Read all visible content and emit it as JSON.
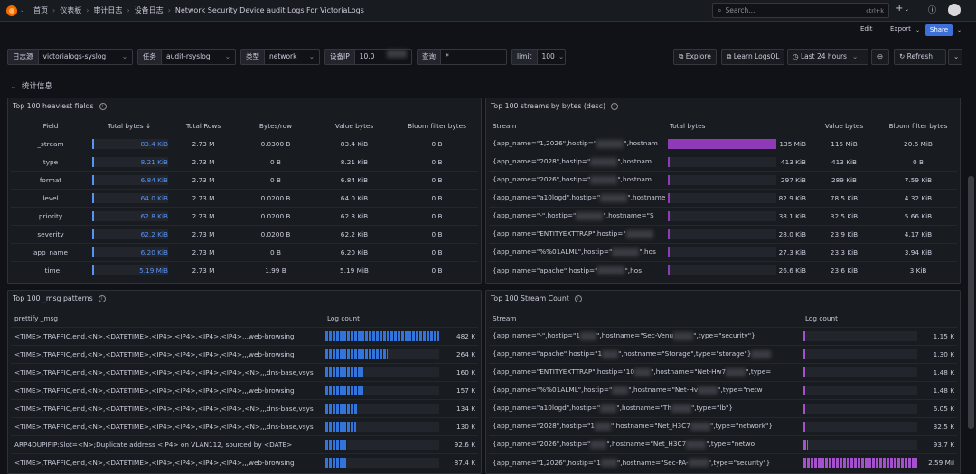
{
  "breadcrumb": [
    "首页",
    "仪表板",
    "审计日志",
    "设备日志",
    "Network Security Device audit Logs For VictoriaLogs"
  ],
  "search": {
    "placeholder": "Search...",
    "shortcut": "ctrl+k"
  },
  "toolbar": {
    "edit": "Edit",
    "export": "Export",
    "share": "Share"
  },
  "filters": [
    {
      "label": "日志源",
      "value": "victorialogs-syslog"
    },
    {
      "label": "任务",
      "value": "audit-rsyslog"
    },
    {
      "label": "类型",
      "value": "network"
    },
    {
      "label": "设备IP",
      "value": "10.0"
    },
    {
      "label": "查询",
      "value": "*"
    },
    {
      "label": "limit",
      "value": "100"
    }
  ],
  "actions": {
    "explore": "Explore",
    "learn": "Learn LogsQL",
    "time_range": "Last 24 hours",
    "refresh": "Refresh"
  },
  "section_title": "统计信息",
  "colors": {
    "blue": "#5794f2",
    "purple": "#8f3bb8",
    "share": "#3d71d9"
  },
  "heaviest_fields": {
    "title": "Top 100 heaviest fields",
    "columns": [
      "Field",
      "Total bytes ↓",
      "Total Rows",
      "Bytes/row",
      "Value bytes",
      "Bloom filter bytes"
    ],
    "rows": [
      {
        "field": "_stream",
        "total_bytes": "83.4 KiB",
        "frac": 1.0,
        "rows": "2.73 M",
        "bpr": "0.0300 B",
        "value_bytes": "83.4 KiB",
        "bloom": "0 B"
      },
      {
        "field": "type",
        "total_bytes": "8.21 KiB",
        "frac": 0.1,
        "rows": "2.73 M",
        "bpr": "0 B",
        "value_bytes": "8.21 KiB",
        "bloom": "0 B"
      },
      {
        "field": "format",
        "total_bytes": "6.84 KiB",
        "frac": 0.08,
        "rows": "2.73 M",
        "bpr": "0 B",
        "value_bytes": "6.84 KiB",
        "bloom": "0 B"
      },
      {
        "field": "level",
        "total_bytes": "64.0 KiB",
        "frac": 0.77,
        "rows": "2.73 M",
        "bpr": "0.0200 B",
        "value_bytes": "64.0 KiB",
        "bloom": "0 B"
      },
      {
        "field": "priority",
        "total_bytes": "62.8 KiB",
        "frac": 0.75,
        "rows": "2.73 M",
        "bpr": "0.0200 B",
        "value_bytes": "62.8 KiB",
        "bloom": "0 B"
      },
      {
        "field": "severity",
        "total_bytes": "62.2 KiB",
        "frac": 0.75,
        "rows": "2.73 M",
        "bpr": "0.0200 B",
        "value_bytes": "62.2 KiB",
        "bloom": "0 B"
      },
      {
        "field": "app_name",
        "total_bytes": "6.20 KiB",
        "frac": 0.07,
        "rows": "2.73 M",
        "bpr": "0 B",
        "value_bytes": "6.20 KiB",
        "bloom": "0 B"
      },
      {
        "field": "_time",
        "total_bytes": "5.19 MiB",
        "frac": 0.06,
        "rows": "2.73 M",
        "bpr": "1.99 B",
        "value_bytes": "5.19 MiB",
        "bloom": "0 B"
      }
    ]
  },
  "streams_by_bytes": {
    "title": "Top 100 streams by bytes (desc)",
    "columns": [
      "Stream",
      "Total bytes",
      "Value bytes",
      "Bloom filter bytes"
    ],
    "rows": [
      {
        "stream": "{app_name=\"1,2026\",hostip=\"",
        "stream2": "\",hostnam",
        "total": "135 MiB",
        "frac": 1.0,
        "value": "115 MiB",
        "bloom": "20.6 MiB"
      },
      {
        "stream": "{app_name=\"2028\",hostip=\"",
        "stream2": "\",hostnam",
        "total": "413 KiB",
        "frac": 0.0,
        "value": "413 KiB",
        "bloom": "0 B"
      },
      {
        "stream": "{app_name=\"2026\",hostip=\"",
        "stream2": "\",hostnam",
        "total": "297 KiB",
        "frac": 0.0,
        "value": "289 KiB",
        "bloom": "7.59 KiB"
      },
      {
        "stream": "{app_name=\"a10logd\",hostip=\"",
        "stream2": "\",hostname=\"",
        "total": "82.9 KiB",
        "frac": 0.0,
        "value": "78.5 KiB",
        "bloom": "4.32 KiB"
      },
      {
        "stream": "{app_name=\"-\",hostip=\"",
        "stream2": "\",hostname=\"S",
        "total": "38.1 KiB",
        "frac": 0.0,
        "value": "32.5 KiB",
        "bloom": "5.66 KiB"
      },
      {
        "stream": "{app_name=\"ENTITYEXTTRAP\",hostip=\"",
        "stream2": "",
        "total": "28.0 KiB",
        "frac": 0.0,
        "value": "23.9 KiB",
        "bloom": "4.17 KiB"
      },
      {
        "stream": "{app_name=\"%%01ALML\",hostip=\"",
        "stream2": "\",hos",
        "total": "27.3 KiB",
        "frac": 0.0,
        "value": "23.3 KiB",
        "bloom": "3.94 KiB"
      },
      {
        "stream": "{app_name=\"apache\",hostip=\"",
        "stream2": "\",hos",
        "total": "26.6 KiB",
        "frac": 0.0,
        "value": "23.6 KiB",
        "bloom": "3 KiB"
      }
    ]
  },
  "msg_patterns": {
    "title": "Top 100 _msg patterns",
    "columns": [
      "prettify _msg",
      "Log count"
    ],
    "rows": [
      {
        "msg": "<TIME>,TRAFFIC,end,<N>,<DATETIME>,<IP4>,<IP4>,<IP4>,<IP4>,,,web-browsing",
        "count": "482 K",
        "frac": 1.0
      },
      {
        "msg": "<TIME>,TRAFFIC,end,<N>,<DATETIME>,<IP4>,<IP4>,<IP4>,<IP4>,,,web-browsing",
        "count": "264 K",
        "frac": 0.55
      },
      {
        "msg": "<TIME>,TRAFFIC,end,<N>,<DATETIME>,<IP4>,<IP4>,<IP4>,<IP4>,<N>,,,dns-base,vsys",
        "count": "160 K",
        "frac": 0.33
      },
      {
        "msg": "<TIME>,TRAFFIC,end,<N>,<DATETIME>,<IP4>,<IP4>,<IP4>,<IP4>,,,web-browsing",
        "count": "157 K",
        "frac": 0.33
      },
      {
        "msg": "<TIME>,TRAFFIC,end,<N>,<DATETIME>,<IP4>,<IP4>,<IP4>,<IP4>,<N>,,,dns-base,vsys",
        "count": "134 K",
        "frac": 0.28
      },
      {
        "msg": "<TIME>,TRAFFIC,end,<N>,<DATETIME>,<IP4>,<IP4>,<IP4>,<IP4>,<N>,,,dns-base,vsys",
        "count": "130 K",
        "frac": 0.27
      },
      {
        "msg": "ARP4DUPIFIP:Slot=<N>;Duplicate address <IP4> on VLAN112, sourced by <DATE>",
        "count": "92.6 K",
        "frac": 0.19
      },
      {
        "msg": "<TIME>,TRAFFIC,end,<N>,<DATETIME>,<IP4>,<IP4>,<IP4>,<IP4>,,,web-browsing",
        "count": "87.4 K",
        "frac": 0.18
      }
    ]
  },
  "stream_count": {
    "title": "Top 100 Stream Count",
    "columns": [
      "Stream",
      "Log count"
    ],
    "rows": [
      {
        "stream": "{app_name=\"-\",hostip=\"1",
        "stream2": "\",hostname=\"Sec-Venu",
        "stream3": "\",type=\"security\"}",
        "count": "1.15 K",
        "frac": 0.0
      },
      {
        "stream": "{app_name=\"apache\",hostip=\"1",
        "stream2": "\",hostname=\"Storage\",type=\"storage\"}",
        "stream3": "",
        "count": "1.30 K",
        "frac": 0.0
      },
      {
        "stream": "{app_name=\"ENTITYEXTTRAP\",hostip=\"10",
        "stream2": "\",hostname=\"Net-Hw7",
        "stream3": "\",type=",
        "count": "1.48 K",
        "frac": 0.0
      },
      {
        "stream": "{app_name=\"%%01ALML\",hostip=\"",
        "stream2": "\",hostname=\"Net-Hv",
        "stream3": "\",type=\"netw",
        "count": "1.48 K",
        "frac": 0.0
      },
      {
        "stream": "{app_name=\"a10logd\",hostip=\"",
        "stream2": "\",hostname=\"Th",
        "stream3": "\",type=\"lb\"}",
        "count": "6.05 K",
        "frac": 0.0
      },
      {
        "stream": "{app_name=\"2028\",hostip=\"1",
        "stream2": "\",hostname=\"Net_H3C7",
        "stream3": "\",type=\"network\"}",
        "count": "32.5 K",
        "frac": 0.01
      },
      {
        "stream": "{app_name=\"2026\",hostip=\"",
        "stream2": "\",hostname=\"Net_H3C7",
        "stream3": "\",type=\"netwo",
        "count": "93.7 K",
        "frac": 0.04
      },
      {
        "stream": "{app_name=\"1,2026\",hostip=\"1",
        "stream2": "\",hostname=\"Sec-PA-",
        "stream3": "\",type=\"security\"}",
        "count": "2.59 Mil",
        "frac": 1.0
      }
    ]
  }
}
